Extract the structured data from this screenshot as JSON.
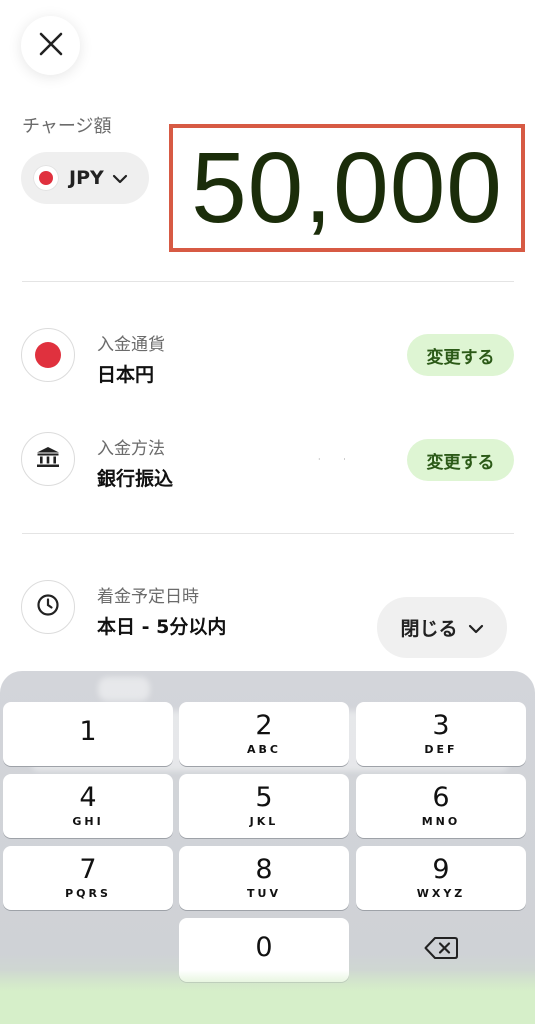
{
  "header": {
    "close_icon": "close-icon"
  },
  "amount": {
    "label": "チャージ額",
    "currency_code": "JPY",
    "value": "50,000"
  },
  "details": {
    "deposit_currency": {
      "label": "入金通貨",
      "value": "日本円",
      "action": "変更する",
      "icon": "japan-flag-icon"
    },
    "deposit_method": {
      "label": "入金方法",
      "value": "銀行振込",
      "action": "変更する",
      "icon": "bank-icon"
    },
    "arrival": {
      "label": "着金予定日時",
      "value": "本日 - 5分以内",
      "icon": "clock-icon"
    }
  },
  "collapse_button": {
    "label": "閉じる"
  },
  "keypad": {
    "keys": [
      {
        "digit": "1",
        "letters": ""
      },
      {
        "digit": "2",
        "letters": "ABC"
      },
      {
        "digit": "3",
        "letters": "DEF"
      },
      {
        "digit": "4",
        "letters": "GHI"
      },
      {
        "digit": "5",
        "letters": "JKL"
      },
      {
        "digit": "6",
        "letters": "MNO"
      },
      {
        "digit": "7",
        "letters": "PQRS"
      },
      {
        "digit": "8",
        "letters": "TUV"
      },
      {
        "digit": "9",
        "letters": "WXYZ"
      },
      {
        "digit": "0",
        "letters": ""
      }
    ],
    "delete_icon": "backspace-icon"
  },
  "colors": {
    "amount_text": "#1b2d0a",
    "highlight_border": "#d75a44",
    "action_bg": "#def5d3",
    "action_text": "#2c5a18",
    "flag_red": "#e0313e"
  }
}
